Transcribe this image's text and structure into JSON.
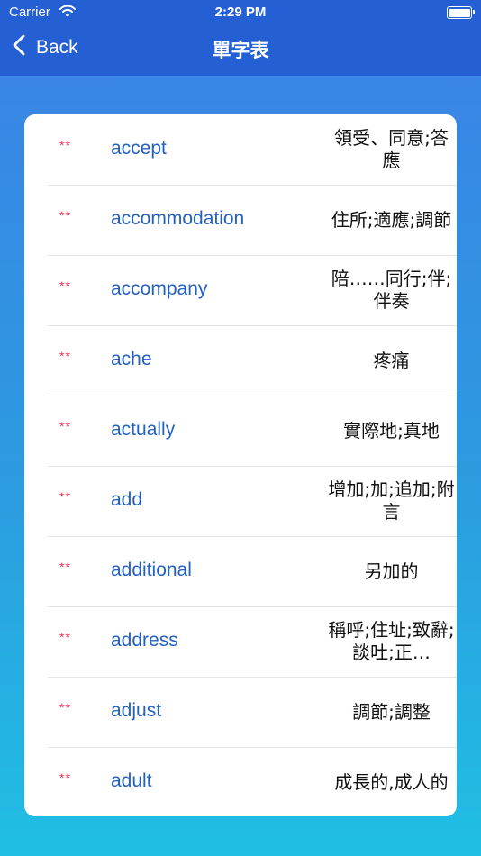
{
  "status": {
    "carrier": "Carrier",
    "time": "2:29 PM"
  },
  "nav": {
    "back_label": "Back",
    "title": "單字表"
  },
  "words": [
    {
      "stars": "**",
      "word": "accept",
      "meaning": "領受、同意;答應"
    },
    {
      "stars": "**",
      "word": "accommodation",
      "meaning": "住所;適應;調節"
    },
    {
      "stars": "**",
      "word": "accompany",
      "meaning": "陪……同行;伴;伴奏"
    },
    {
      "stars": "**",
      "word": "ache",
      "meaning": "疼痛"
    },
    {
      "stars": "**",
      "word": "actually",
      "meaning": "實際地;真地"
    },
    {
      "stars": "**",
      "word": "add",
      "meaning": "增加;加;追加;附言"
    },
    {
      "stars": "**",
      "word": "additional",
      "meaning": "另加的"
    },
    {
      "stars": "**",
      "word": "address",
      "meaning": "稱呼;住址;致辭;談吐;正…"
    },
    {
      "stars": "**",
      "word": "adjust",
      "meaning": "調節;調整"
    },
    {
      "stars": "**",
      "word": "adult",
      "meaning": "成長的,成人的"
    }
  ]
}
